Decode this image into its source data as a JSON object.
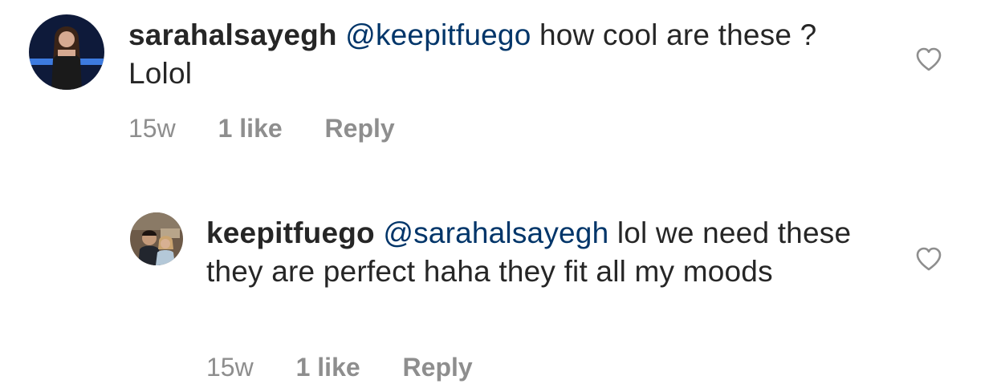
{
  "comments": [
    {
      "username": "sarahalsayegh",
      "mention": "@keepitfuego",
      "text": " how cool are these ? Lolol",
      "age": "15w",
      "likes": "1 like",
      "reply_label": "Reply",
      "like_icon": "heart-outline-icon"
    },
    {
      "username": "keepitfuego",
      "mention": "@sarahalsayegh",
      "text": " lol we need these they are perfect haha they fit all my moods",
      "age": "15w",
      "likes": "1 like",
      "reply_label": "Reply",
      "like_icon": "heart-outline-icon"
    }
  ],
  "colors": {
    "text": "#262626",
    "mention": "#003569",
    "meta": "#8e8e8e",
    "icon": "#8e8e8e"
  }
}
